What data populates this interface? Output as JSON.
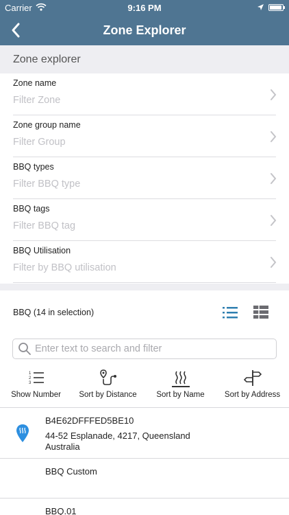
{
  "status_bar": {
    "carrier": "Carrier",
    "time": "9:16 PM"
  },
  "nav": {
    "title": "Zone Explorer",
    "back_icon": "chevron-left-icon"
  },
  "section_header": "Zone explorer",
  "filters": [
    {
      "label": "Zone name",
      "placeholder": "Filter Zone"
    },
    {
      "label": "Zone group name",
      "placeholder": "Filter Group"
    },
    {
      "label": "BBQ types",
      "placeholder": "Filter BBQ type"
    },
    {
      "label": "BBQ tags",
      "placeholder": "Filter BBQ tag"
    },
    {
      "label": "BBQ Utilisation",
      "placeholder": "Filter by BBQ utilisation"
    }
  ],
  "bbq_section": {
    "label": "BBQ (14 in selection)",
    "active_view": "list"
  },
  "search": {
    "placeholder": "Enter text to search and filter",
    "value": ""
  },
  "sort_options": [
    {
      "label": "Show Number",
      "icon": "numbered-list-icon"
    },
    {
      "label": "Sort by Distance",
      "icon": "route-icon"
    },
    {
      "label": "Sort by Name",
      "icon": "heat-waves-icon",
      "selected": true
    },
    {
      "label": "Sort by Address",
      "icon": "signpost-icon"
    }
  ],
  "items": [
    {
      "id": "B4E62DFFFED5BE10",
      "address_line1": "44-52 Esplanade, 4217, Queensland",
      "address_line2": "Australia",
      "has_pin": true
    },
    {
      "id": "BBQ Custom",
      "address_line1": "",
      "address_line2": "",
      "has_pin": false
    },
    {
      "id": "BBQ.01",
      "address_line1": "",
      "address_line2": "",
      "has_pin": false
    }
  ],
  "colors": {
    "nav_background": "#4f7592",
    "accent": "#2f7fb0",
    "pin": "#2d8fe0",
    "placeholder": "#c1c1c6"
  }
}
